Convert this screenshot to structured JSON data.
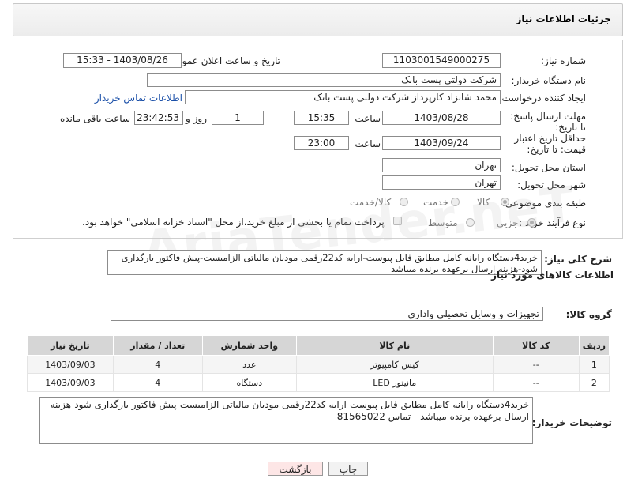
{
  "header": {
    "title": "جزئیات اطلاعات نیاز"
  },
  "form": {
    "need_number_label": "شماره نیاز:",
    "need_number": "1103001549000275",
    "announce_label": "تاریخ و ساعت اعلان عمومی:",
    "announce_value": "1403/08/26 - 15:33",
    "buyer_org_label": "نام دستگاه خریدار:",
    "buyer_org": "شرکت دولتی پست بانک",
    "creator_label": "ایجاد کننده درخواست:",
    "creator": "محمد شانزاد کارپرداز شرکت دولتی پست بانک",
    "contact_link": "اطلاعات تماس خریدار",
    "deadline_label": "مهلت ارسال پاسخ: تا تاریخ:",
    "deadline_date": "1403/08/28",
    "time_label": "ساعت",
    "deadline_time": "15:35",
    "days_value": "1",
    "days_label": "روز و",
    "remaining_time": "23:42:53",
    "remaining_label": "ساعت باقی مانده",
    "validity_label": "حداقل تاریخ اعتبار قیمت: تا تاریخ:",
    "validity_date": "1403/09/24",
    "validity_time": "23:00",
    "province_label": "استان محل تحویل:",
    "province": "تهران",
    "city_label": "شهر محل تحویل:",
    "city": "تهران",
    "category_label": "طبقه بندی موضوعی:",
    "category_options": [
      "کالا",
      "خدمت",
      "کالا/خدمت"
    ],
    "process_label": "نوع فرآیند خرید :",
    "process_options": [
      "جزیی",
      "متوسط"
    ],
    "payment_note": "پرداخت تمام یا بخشی از مبلغ خرید،از محل \"اسناد خزانه اسلامی\" خواهد بود."
  },
  "description": {
    "label": "شرح کلی نیاز:",
    "text": "خرید4دستگاه رایانه کامل مطابق فایل پیوست-ارایه کد22رقمی مودیان مالیاتی الزامیست-پیش فاکتور بارگذاری شود-هزینه ارسال برعهده برنده میباشد"
  },
  "goods": {
    "section_title": "اطلاعات کالاهای مورد نیاز",
    "group_label": "گروه کالا:",
    "group_value": "تجهیزات و وسایل تحصیلی واداری",
    "columns": [
      "ردیف",
      "کد کالا",
      "نام کالا",
      "واحد شمارش",
      "تعداد / مقدار",
      "تاریخ نیاز"
    ],
    "rows": [
      [
        "1",
        "--",
        "کیس کامپیوتر",
        "عدد",
        "4",
        "1403/09/03"
      ],
      [
        "2",
        "--",
        "مانیتور LED",
        "دستگاه",
        "4",
        "1403/09/03"
      ]
    ]
  },
  "buyer_notes": {
    "label": "توضیحات خریدار:",
    "text": "خرید4دستگاه رایانه کامل مطابق فایل پیوست-ارایه کد22رقمی مودیان مالیاتی الزامیست-پیش فاکتور بارگذاری شود-هزینه ارسال برعهده برنده میباشد - تماس 81565022"
  },
  "buttons": {
    "print": "چاپ",
    "back": "بازگشت"
  }
}
